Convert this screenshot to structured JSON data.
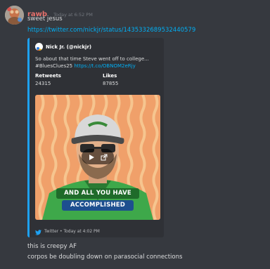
{
  "message": {
    "username": "rawb",
    "timestamp": "Today at 6:52 PM",
    "line1": "sweet jesus",
    "link": "https://twitter.com/nickjr/status/1435332689532440579",
    "line2": "this is creepy AF",
    "line3": "corpos be doubling down on parasocial connections"
  },
  "embed": {
    "author": "Nick Jr. (@nickjr)",
    "desc_line1": "So about that time Steve went off to college...",
    "hashtag": "#BluesClues25",
    "short_link": "https://t.co/OBNOM2eRjy",
    "fields": [
      {
        "name": "Retweets",
        "value": "24315"
      },
      {
        "name": "Likes",
        "value": "87855"
      }
    ],
    "video_caption_line1": "AND ALL YOU HAVE",
    "video_caption_line2": "ACCOMPLISHED",
    "footer": "Twitter • Today at 4:02 PM"
  },
  "colors": {
    "background": "#36393f",
    "embed_bg": "#2f3136",
    "embed_accent": "#1da1f2",
    "username": "#e8716c",
    "link": "#00aff4"
  }
}
